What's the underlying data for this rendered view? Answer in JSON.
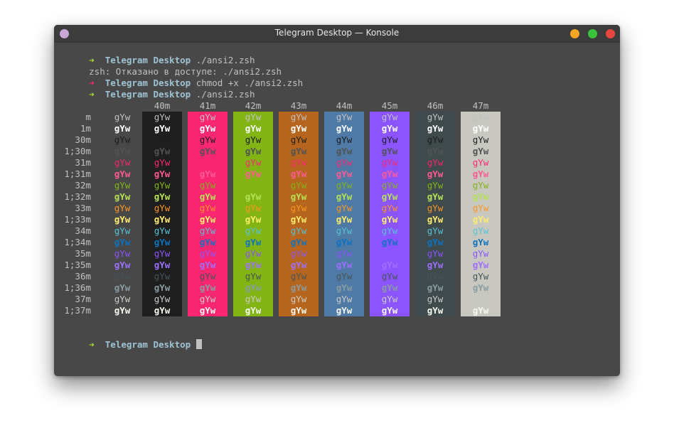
{
  "window": {
    "title": "Telegram Desktop — Konsole"
  },
  "terminal": {
    "lines": [
      {
        "arrow": "➜",
        "dir": "Telegram Desktop",
        "cmd": " ./ansi2.zsh",
        "status": "ok"
      },
      {
        "text": "zsh: Отказано в доступе: ./ansi2.zsh"
      },
      {
        "arrow": "➜",
        "dir": "Telegram Desktop",
        "cmd": " chmod +x ./ansi2.zsh",
        "status": "err"
      },
      {
        "arrow": "➜",
        "dir": "Telegram Desktop",
        "cmd": " ./ansi2.zsh",
        "status": "ok"
      }
    ],
    "prompt": {
      "arrow": "➜",
      "dir": "Telegram Desktop"
    }
  },
  "colortable": {
    "sample": "gYw",
    "bg_headers": [
      "",
      "40m",
      "41m",
      "42m",
      "43m",
      "44m",
      "45m",
      "46m",
      "47m"
    ],
    "bg_colors": [
      "",
      "#1e1e1e",
      "#f92672",
      "#82b414",
      "#b5651d",
      "#4f7aa6",
      "#8c54fe",
      "#3e4a4c",
      "#c8c8c0"
    ],
    "row_labels": [
      "m",
      "1m",
      "30m",
      "1;30m",
      "31m",
      "1;31m",
      "32m",
      "1;32m",
      "33m",
      "1;33m",
      "34m",
      "1;34m",
      "35m",
      "1;35m",
      "36m",
      "1;36m",
      "37m",
      "1;37m"
    ],
    "fg_colors": [
      "#c0c0c0",
      "#ffffff",
      "#1b1d1e",
      "#505354",
      "#f92672",
      "#ff5995",
      "#82b414",
      "#b6e354",
      "#fd971f",
      "#feed6c",
      "#56c2d6",
      "#0c73c2",
      "#8c54fe",
      "#9e6ffe",
      "#465457",
      "#899ca1",
      "#ccccc6",
      "#f8f8f2"
    ]
  },
  "colors": {
    "terminal_bg": "#484848",
    "titlebar_bg": "#3c3c3c",
    "prompt_arrow_ok": "#a6e22e",
    "prompt_arrow_err": "#f92672",
    "prompt_dir": "#9ec3d4"
  }
}
